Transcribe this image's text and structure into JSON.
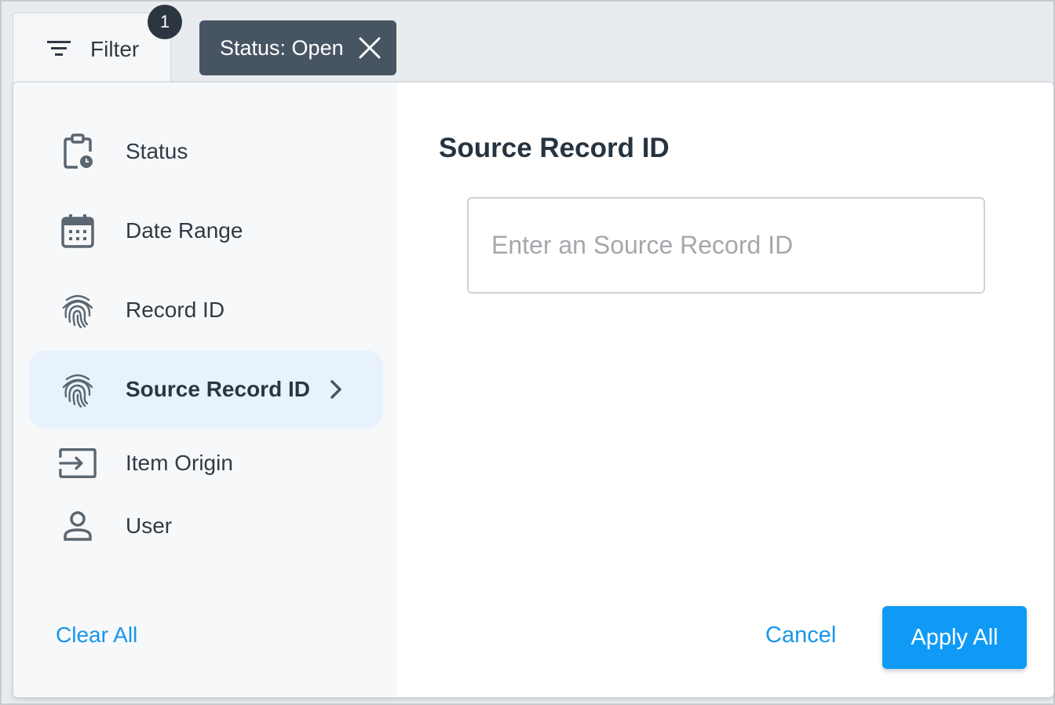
{
  "filter_button": {
    "label": "Filter",
    "icon": "filter-icon",
    "badge_count": "1"
  },
  "active_chips": [
    {
      "label": "Status: Open",
      "close_icon": "close-icon"
    }
  ],
  "sidebar": {
    "items": [
      {
        "label": "Status",
        "icon": "clipboard-clock-icon",
        "active": false
      },
      {
        "label": "Date Range",
        "icon": "calendar-icon",
        "active": false
      },
      {
        "label": "Record ID",
        "icon": "fingerprint-icon",
        "active": false
      },
      {
        "label": "Source Record ID",
        "icon": "fingerprint-icon",
        "active": true
      },
      {
        "label": "Item Origin",
        "icon": "input-arrow-icon",
        "active": false
      },
      {
        "label": "User",
        "icon": "user-icon",
        "active": false
      }
    ],
    "clear_all_label": "Clear All"
  },
  "main": {
    "title": "Source Record ID",
    "input": {
      "placeholder": "Enter an Source Record ID",
      "value": ""
    }
  },
  "footer": {
    "cancel_label": "Cancel",
    "apply_label": "Apply All"
  },
  "colors": {
    "accent": "#0f9bf5",
    "link": "#1896e8",
    "chip_bg": "#475563",
    "active_item_bg": "#e8f2fc",
    "text": "#2f3b45"
  }
}
